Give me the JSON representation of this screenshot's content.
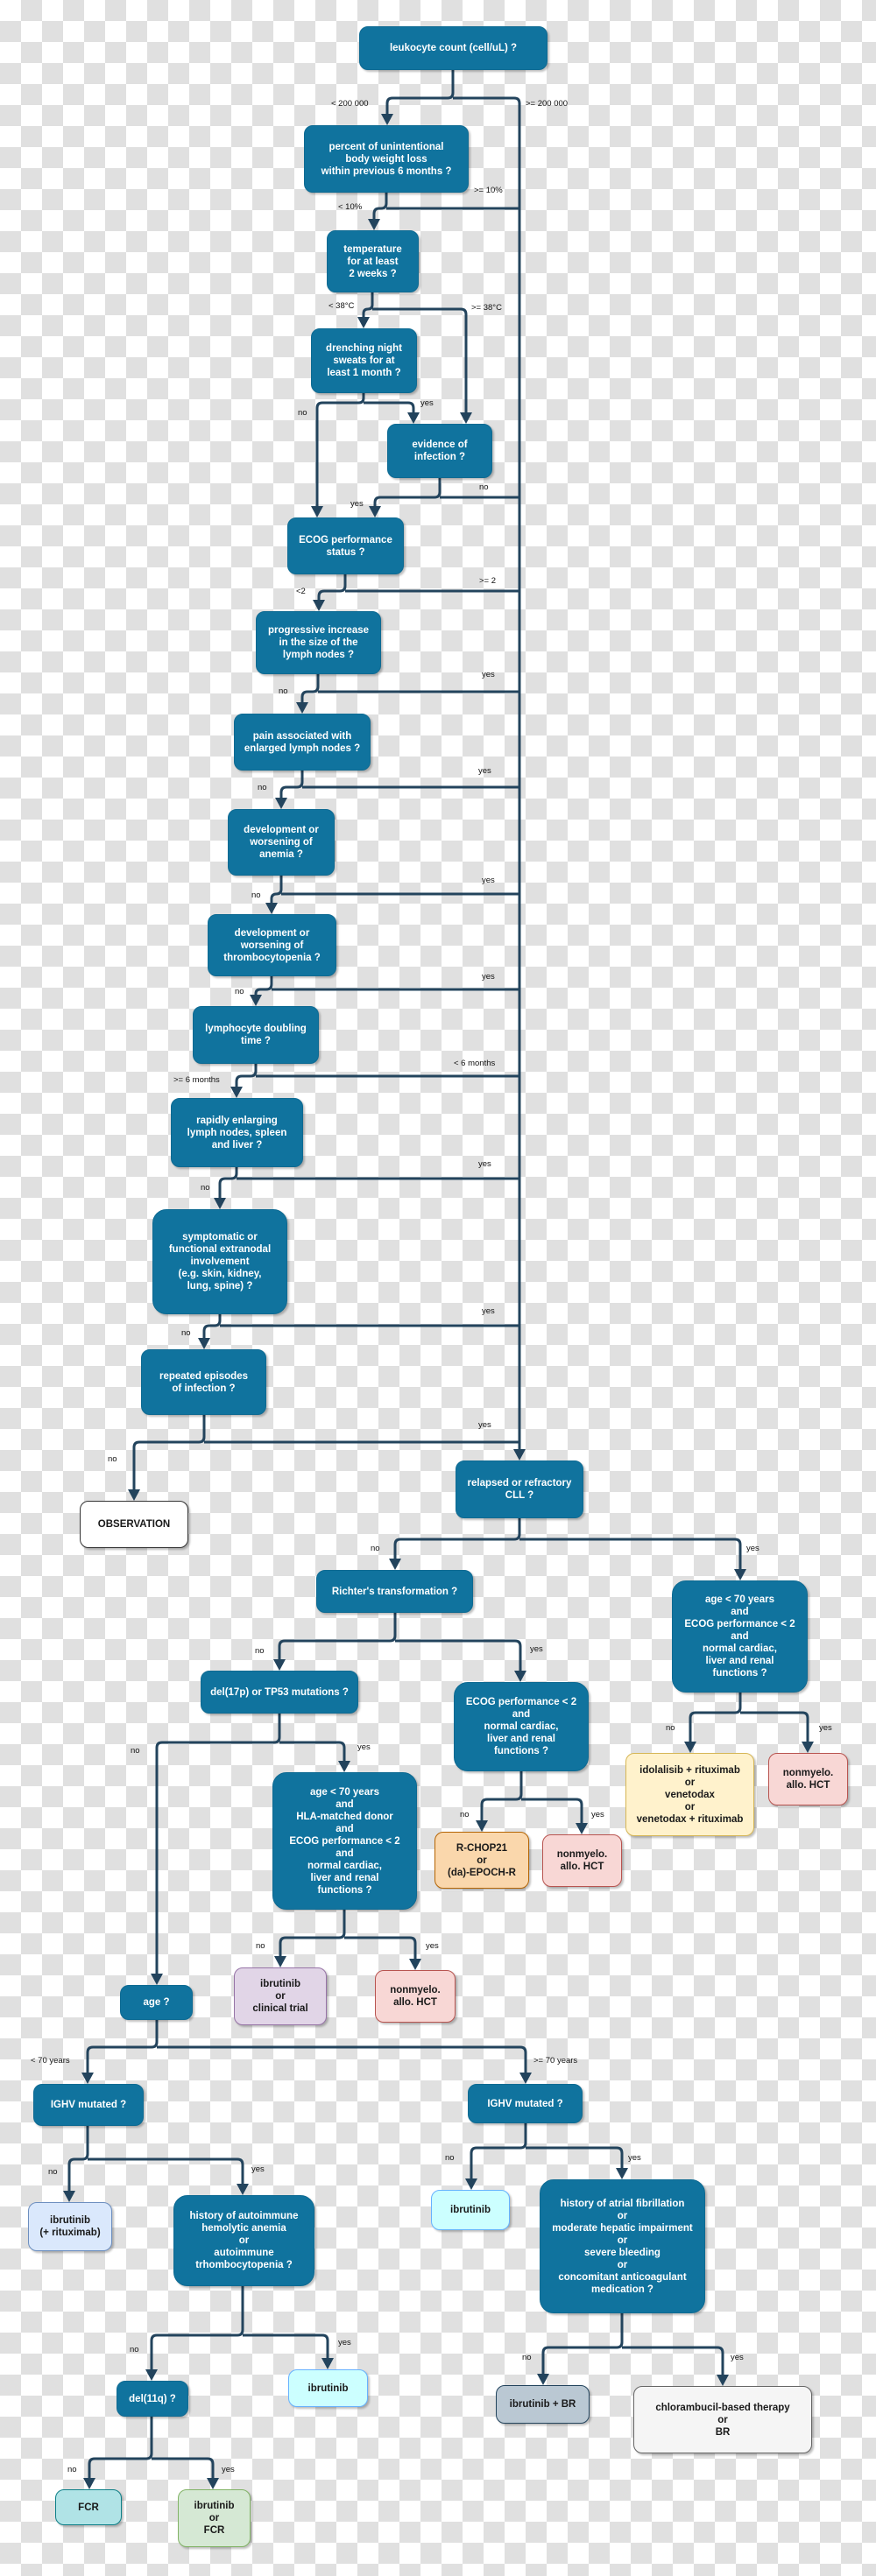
{
  "diagram": {
    "colors": {
      "question": "#10739E",
      "connector": "#23445D"
    },
    "nodes": {
      "leukocyte": "leukocyte count (cell/uL) ?",
      "weight_loss": "percent of unintentional\nbody weight loss\nwithin previous 6 months ?",
      "temperature": "temperature\nfor at least\n2 weeks ?",
      "night_sweats": "drenching night\nsweats for at\nleast 1 month ?",
      "infection_evidence": "evidence of\ninfection ?",
      "ecog_status": "ECOG performance\nstatus ?",
      "progressive_lymph": "progressive increase\nin the size of the\nlymph nodes ?",
      "pain_lymph": "pain associated with\nenlarged lymph nodes ?",
      "anemia": "development or\nworsening of\nanemia ?",
      "thrombocytopenia": "development or\nworsening of\nthrombocytopenia ?",
      "lymphocyte_doubling": "lymphocyte doubling\ntime ?",
      "rapid_enlarging": "rapidly enlarging\nlymph nodes, spleen\nand liver ?",
      "extranodal": "symptomatic or\nfunctional extranodal\ninvolvement\n(e.g. skin, kidney,\nlung, spine) ?",
      "repeated_infection": "repeated episodes\nof infection ?",
      "observation": "OBSERVATION",
      "relapsed": "relapsed or refractory\nCLL ?",
      "richter": "Richter's transformation ?",
      "relapsed_fitness": "age < 70 years\nand\nECOG performance < 2\nand\nnormal cardiac,\nliver and renal\nfunctions ?",
      "idelalisib": "idolalisib + rituximab\nor\nvenetodax\nor\nvenetodax + rituximab",
      "relapsed_hct": "nonmyelo.\nallo. HCT",
      "richter_fitness": "ECOG performance < 2\nand\nnormal cardiac,\nliver and renal\nfunctions ?",
      "rchop": "R-CHOP21\nor\n(da)-EPOCH-R",
      "richter_hct": "nonmyelo.\nallo. HCT",
      "del17p": "del(17p) or TP53 mutations ?",
      "del17p_fitness": "age < 70 years\nand\nHLA-matched donor\nand\nECOG performance < 2\nand\nnormal cardiac,\nliver and renal\nfunctions ?",
      "ibrutinib_trial": "ibrutinib\nor\nclinical trial",
      "del17p_hct": "nonmyelo.\nallo. HCT",
      "age": "age ?",
      "ighv_young": "IGHV mutated ?",
      "ibrutinib_ritux": "ibrutinib\n(+ rituximab)",
      "autoimmune": "history of autoimmune\nhemolytic anemia\nor\nautoimmune\ntrhombocytopenia ?",
      "del11q": "del(11q) ?",
      "fcr": "FCR",
      "ibrutinib_or_fcr": "ibrutinib\nor\nFCR",
      "ibrutinib_auto": "ibrutinib",
      "ighv_old": "IGHV mutated ?",
      "ibrutinib_old": "ibrutinib",
      "atrial": "history of atrial fibrillation\nor\nmoderate hepatic impairment\nor\nsevere bleeding\nor\nconcomitant anticoagulant\nmedication ?",
      "ibrutinib_br": "ibrutinib + BR",
      "chlorambucil": "chlorambucil-based therapy\nor\nBR"
    },
    "labels": {
      "leuk_low": "< 200 000",
      "leuk_high": ">= 200 000",
      "wl_low": "< 10%",
      "wl_high": ">= 10%",
      "temp_low": "< 38°C",
      "temp_high": ">= 38°C",
      "sweats_no": "no",
      "sweats_yes": "yes",
      "inf_yes": "yes",
      "inf_no": "no",
      "ecog_low": "<2",
      "ecog_high": ">= 2",
      "prog_no": "no",
      "prog_yes": "yes",
      "pain_no": "no",
      "pain_yes": "yes",
      "anemia_no": "no",
      "anemia_yes": "yes",
      "thrombo_no": "no",
      "thrombo_yes": "yes",
      "ldt_high": ">= 6 months",
      "ldt_low": "< 6 months",
      "rapid_no": "no",
      "rapid_yes": "yes",
      "extra_no": "no",
      "extra_yes": "yes",
      "rep_no": "no",
      "rep_yes": "yes",
      "rel_no": "no",
      "rel_yes": "yes",
      "rich_no": "no",
      "rich_yes": "yes",
      "relfit_no": "no",
      "relfit_yes": "yes",
      "richfit_no": "no",
      "richfit_yes": "yes",
      "d17_no": "no",
      "d17_yes": "yes",
      "d17fit_no": "no",
      "d17fit_yes": "yes",
      "age_young": "< 70 years",
      "age_old": ">= 70 years",
      "ighvy_no": "no",
      "ighvy_yes": "yes",
      "auto_no": "no",
      "auto_yes": "yes",
      "d11_no": "no",
      "d11_yes": "yes",
      "ighvo_no": "no",
      "ighvo_yes": "yes",
      "atrial_no": "no",
      "atrial_yes": "yes"
    }
  }
}
